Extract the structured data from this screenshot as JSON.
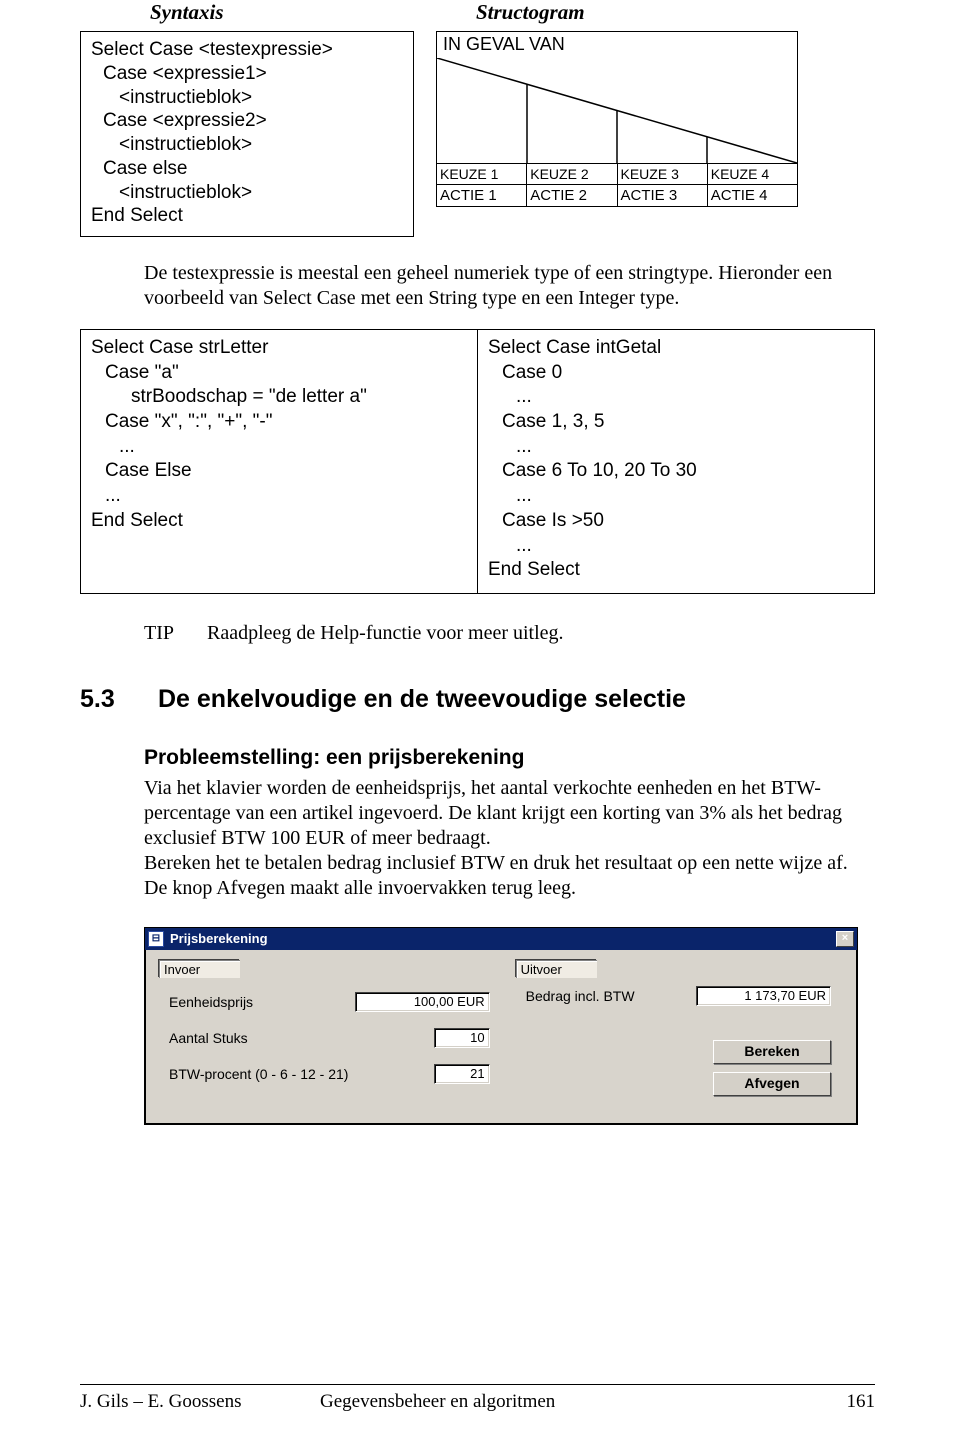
{
  "headings": {
    "syntaxis": "Syntaxis",
    "structogram": "Structogram"
  },
  "syntax_block": {
    "l1": "Select Case <testexpressie>",
    "l2": "Case <expressie1>",
    "l3": "<instructieblok>",
    "l4": "Case <expressie2>",
    "l5": "<instructieblok>",
    "l6": "Case else",
    "l7": "<instructieblok>",
    "l8": "End Select"
  },
  "structo": {
    "header": "IN GEVAL VAN",
    "keuze": [
      "KEUZE 1",
      "KEUZE 2",
      "KEUZE 3",
      "KEUZE 4"
    ],
    "actie": [
      "ACTIE 1",
      "ACTIE 2",
      "ACTIE 3",
      "ACTIE 4"
    ]
  },
  "intro_para": "De testexpressie is meestal een geheel numeriek type of een stringtype. Hieronder een voorbeeld van Select Case met een String type en een Integer type.",
  "example_left": {
    "l1": "Select Case strLetter",
    "l2": "Case \"a\"",
    "l3": "strBoodschap = \"de letter a\"",
    "l4": "Case \"x\", \":\", \"+\", \"-\"",
    "l5": "...",
    "l6": "Case Else",
    "l7": "...",
    "l8": "End Select"
  },
  "example_right": {
    "l1": "Select Case intGetal",
    "l2": "Case 0",
    "l3": "...",
    "l4": "Case 1, 3, 5",
    "l5": "...",
    "l6": "Case 6 To 10, 20 To 30",
    "l7": "...",
    "l8": "Case Is >50",
    "l9": "...",
    "l10": "End Select"
  },
  "tip": {
    "label": "TIP",
    "text": "Raadpleeg de Help-functie voor meer uitleg."
  },
  "section": {
    "num": "5.3",
    "title": "De enkelvoudige en de tweevoudige selectie"
  },
  "problem": {
    "heading": "Probleemstelling: een prijsberekening",
    "p1": "Via het klavier worden de eenheidsprijs, het aantal verkochte eenheden en het BTW-percentage van een artikel ingevoerd. De klant krijgt een korting van 3% als het bedrag exclusief BTW 100 EUR of meer bedraagt.",
    "p2": "Bereken het te betalen bedrag inclusief BTW en druk het resultaat op een nette wijze af. De knop Afvegen maakt alle invoervakken terug leeg."
  },
  "form": {
    "window_title": "Prijsberekening",
    "close_glyph": "×",
    "legend_in": "Invoer",
    "legend_out": "Uitvoer",
    "labels": {
      "eenheidsprijs": "Eenheidsprijs",
      "aantal": "Aantal Stuks",
      "btw": "BTW-procent (0 - 6 - 12 - 21)",
      "bedrag": "Bedrag incl. BTW"
    },
    "values": {
      "eenheidsprijs": "100,00 EUR",
      "aantal": "10",
      "btw": "21",
      "bedrag": "1 173,70 EUR"
    },
    "buttons": {
      "bereken": "Bereken",
      "afvegen": "Afvegen"
    }
  },
  "footer": {
    "left": "J. Gils – E. Goossens",
    "center": "Gegevensbeheer en algoritmen",
    "right": "161"
  }
}
